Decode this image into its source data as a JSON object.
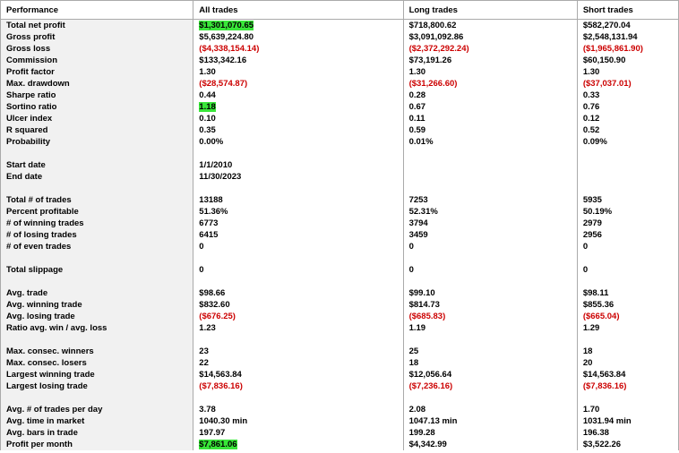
{
  "chart_data": {
    "type": "table",
    "title": "Performance",
    "columns": [
      "Performance",
      "All trades",
      "Long trades",
      "Short trades"
    ],
    "rows": [
      {
        "label": "Total net profit",
        "all": "$1,301,070.65",
        "long": "$718,800.62",
        "short": "$582,270.04",
        "bold": true,
        "hl_all": true
      },
      {
        "label": "Gross profit",
        "all": "$5,639,224.80",
        "long": "$3,091,092.86",
        "short": "$2,548,131.94",
        "bold": true
      },
      {
        "label": "Gross loss",
        "all": "($4,338,154.14)",
        "long": "($2,372,292.24)",
        "short": "($1,965,861.90)",
        "bold": true,
        "neg": true
      },
      {
        "label": "Commission",
        "all": "$133,342.16",
        "long": "$73,191.26",
        "short": "$60,150.90",
        "bold": true
      },
      {
        "label": "Profit factor",
        "all": "1.30",
        "long": "1.30",
        "short": "1.30",
        "bold": true
      },
      {
        "label": "Max. drawdown",
        "all": "($28,574.87)",
        "long": "($31,266.60)",
        "short": "($37,037.01)",
        "bold": true,
        "neg": true
      },
      {
        "label": "Sharpe ratio",
        "all": "0.44",
        "long": "0.28",
        "short": "0.33",
        "bold": true
      },
      {
        "label": "Sortino ratio",
        "all": "1.18",
        "long": "0.67",
        "short": "0.76",
        "bold": true,
        "hl_all": true
      },
      {
        "label": "Ulcer index",
        "all": "0.10",
        "long": "0.11",
        "short": "0.12",
        "bold": true
      },
      {
        "label": "R squared",
        "all": "0.35",
        "long": "0.59",
        "short": "0.52",
        "bold": true
      },
      {
        "label": "Probability",
        "all": "0.00%",
        "long": "0.01%",
        "short": "0.09%",
        "bold": true
      },
      {
        "spacer": true
      },
      {
        "label": "Start date",
        "all": "1/1/2010",
        "long": "",
        "short": "",
        "bold": true
      },
      {
        "label": "End date",
        "all": "11/30/2023",
        "long": "",
        "short": "",
        "bold": true
      },
      {
        "spacer": true
      },
      {
        "label": "Total # of trades",
        "all": "13188",
        "long": "7253",
        "short": "5935",
        "bold": true
      },
      {
        "label": "Percent profitable",
        "all": "51.36%",
        "long": "52.31%",
        "short": "50.19%",
        "bold": true
      },
      {
        "label": "# of winning trades",
        "all": "6773",
        "long": "3794",
        "short": "2979",
        "bold": true
      },
      {
        "label": "# of losing trades",
        "all": "6415",
        "long": "3459",
        "short": "2956",
        "bold": true
      },
      {
        "label": "# of even trades",
        "all": "0",
        "long": "0",
        "short": "0",
        "bold": true
      },
      {
        "spacer": true
      },
      {
        "label": "Total slippage",
        "all": "0",
        "long": "0",
        "short": "0",
        "bold": true
      },
      {
        "spacer": true
      },
      {
        "label": "Avg. trade",
        "all": "$98.66",
        "long": "$99.10",
        "short": "$98.11",
        "bold": true
      },
      {
        "label": "Avg. winning trade",
        "all": "$832.60",
        "long": "$814.73",
        "short": "$855.36",
        "bold": true
      },
      {
        "label": "Avg. losing trade",
        "all": "($676.25)",
        "long": "($685.83)",
        "short": "($665.04)",
        "bold": true,
        "neg": true
      },
      {
        "label": "Ratio avg. win / avg. loss",
        "all": "1.23",
        "long": "1.19",
        "short": "1.29",
        "bold": true
      },
      {
        "spacer": true
      },
      {
        "label": "Max. consec. winners",
        "all": "23",
        "long": "25",
        "short": "18",
        "bold": true
      },
      {
        "label": "Max. consec. losers",
        "all": "22",
        "long": "18",
        "short": "20",
        "bold": true
      },
      {
        "label": "Largest winning trade",
        "all": "$14,563.84",
        "long": "$12,056.64",
        "short": "$14,563.84",
        "bold": true
      },
      {
        "label": "Largest losing trade",
        "all": "($7,836.16)",
        "long": "($7,236.16)",
        "short": "($7,836.16)",
        "bold": true,
        "neg": true
      },
      {
        "spacer": true
      },
      {
        "label": "Avg. # of trades per day",
        "all": "3.78",
        "long": "2.08",
        "short": "1.70",
        "bold": true
      },
      {
        "label": "Avg. time in market",
        "all": "1040.30 min",
        "long": "1047.13 min",
        "short": "1031.94 min",
        "bold": true
      },
      {
        "label": "Avg. bars in trade",
        "all": "197.97",
        "long": "199.28",
        "short": "196.38",
        "bold": true
      },
      {
        "label": "Profit per month",
        "all": "$7,861.06",
        "long": "$4,342.99",
        "short": "$3,522.26",
        "bold": true,
        "hl_all": true
      }
    ]
  }
}
